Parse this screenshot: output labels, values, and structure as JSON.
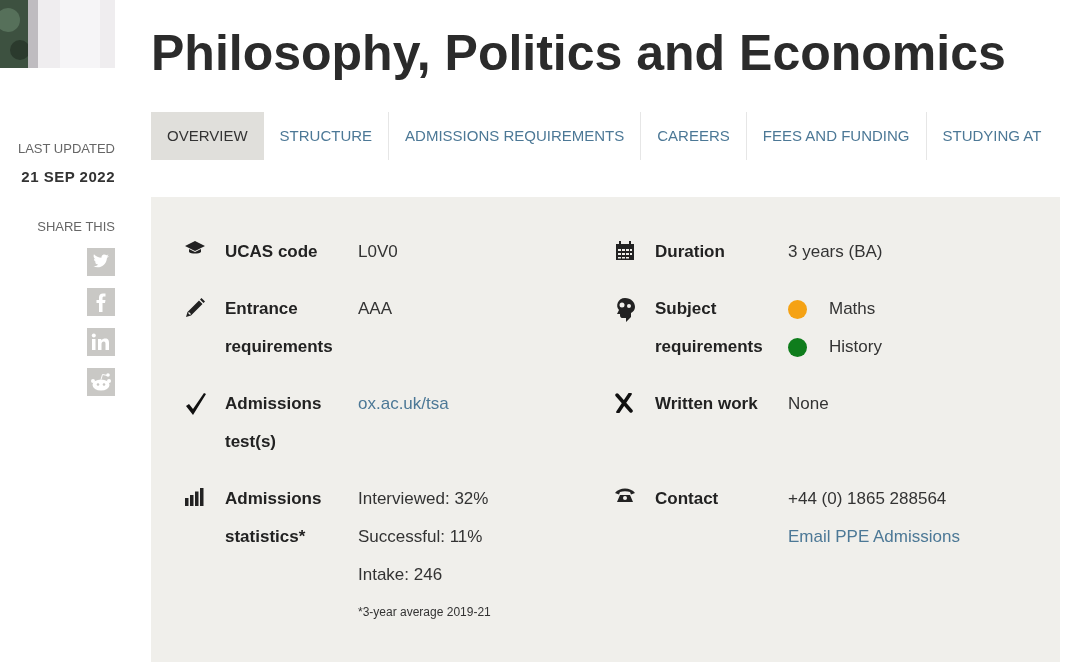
{
  "page_title": "Philosophy, Politics and Economics",
  "sidebar": {
    "updated_label": "LAST UPDATED",
    "updated_date": "21 SEP 2022",
    "share_label": "SHARE THIS"
  },
  "tabs": [
    {
      "label": "OVERVIEW",
      "selected": true
    },
    {
      "label": "STRUCTURE",
      "selected": false
    },
    {
      "label": "ADMISSIONS REQUIREMENTS",
      "selected": false
    },
    {
      "label": "CAREERS",
      "selected": false
    },
    {
      "label": "FEES AND FUNDING",
      "selected": false
    },
    {
      "label": "STUDYING AT",
      "selected": false
    }
  ],
  "facts": [
    {
      "label": "UCAS code",
      "values": [
        {
          "kind": "text",
          "text": "L0V0"
        }
      ]
    },
    {
      "label": "Duration",
      "values": [
        {
          "kind": "text",
          "text": "3 years (BA)"
        }
      ]
    },
    {
      "label": "Entrance requirements",
      "values": [
        {
          "kind": "text",
          "text": "AAA"
        }
      ]
    },
    {
      "label": "Subject requirements",
      "values": [
        {
          "kind": "subject",
          "text": "Maths",
          "color": "#f5a214"
        },
        {
          "kind": "subject",
          "text": "History",
          "color": "#0f7d1c"
        }
      ]
    },
    {
      "label": "Admissions test(s)",
      "values": [
        {
          "kind": "link",
          "text": "ox.ac.uk/tsa"
        }
      ]
    },
    {
      "label": "Written work",
      "values": [
        {
          "kind": "text",
          "text": "None"
        }
      ]
    },
    {
      "label": "Admissions statistics*",
      "values": [
        {
          "kind": "text",
          "text": "Interviewed: 32%"
        },
        {
          "kind": "text",
          "text": "Successful: 11%"
        },
        {
          "kind": "text",
          "text": "Intake: 246"
        },
        {
          "kind": "note",
          "text": "*3-year average 2019-21"
        }
      ]
    },
    {
      "label": "Contact",
      "values": [
        {
          "kind": "text",
          "text": "+44 (0) 1865 288564"
        },
        {
          "kind": "link",
          "text": "Email PPE Admissions"
        }
      ]
    }
  ]
}
